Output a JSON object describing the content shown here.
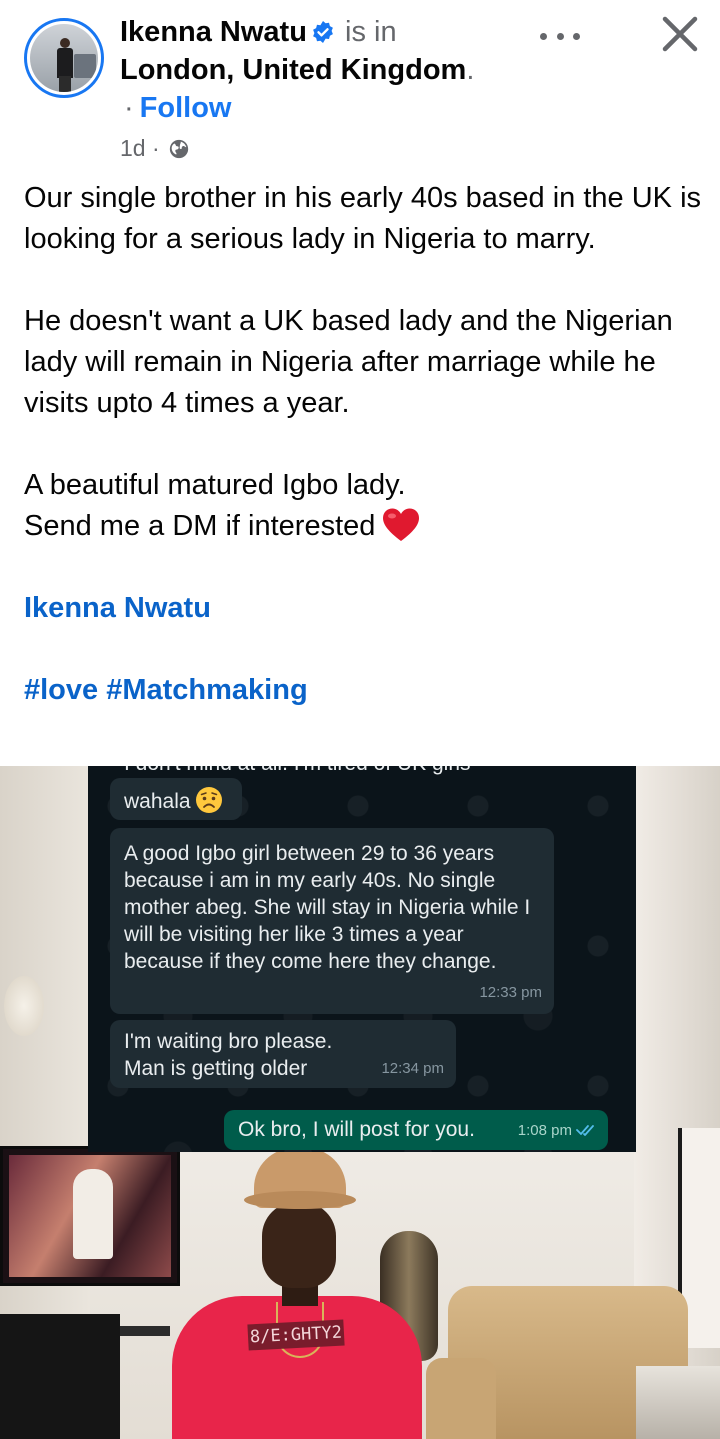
{
  "post": {
    "author": "Ikenna Nwatu",
    "checkin_prefix": "is in",
    "location": "London, United Kingdom",
    "location_suffix": ".",
    "follow_sep": "·",
    "follow_label": "Follow",
    "time_ago": "1d",
    "meta_sep": "·",
    "visibility_icon": "globe-icon",
    "text": {
      "p1": "Our single brother in his early 40s based in the UK is looking for a serious lady in Nigeria to marry.",
      "p2": "He doesn't want a UK based lady and the Nigerian lady will remain in Nigeria after marriage while he visits upto 4 times a year.",
      "p3a": "A beautiful matured Igbo lady.",
      "p3b": "Send me a DM if interested"
    },
    "author_tag": "Ikenna Nwatu",
    "hashtags": "#love #Matchmaking"
  },
  "chat": {
    "cut_line": "I don't mind at all. I'm tired of UK girls",
    "msg1_text": "wahala",
    "msg2_text": "A good Igbo girl between 29 to 36 years because i am in my early 40s. No single mother abeg. She will stay in Nigeria while I will be visiting her like 3 times a year because if they come here they change.",
    "msg2_time": "12:33 pm",
    "msg3_text": "I'm waiting bro please. Man is getting older",
    "msg3_time": "12:34 pm",
    "msg4_text": "Ok bro, I will post for you.",
    "msg4_time": "1:08 pm"
  },
  "photo": {
    "shirt_text": "8/E:GHTY2"
  },
  "colors": {
    "accent": "#1877f2",
    "link": "#0a63c9",
    "secondary_text": "#65676b",
    "chat_bg": "#0b141a",
    "bubble_in": "#1f2c33",
    "bubble_out": "#005c4b",
    "shirt": "#e8254a"
  }
}
